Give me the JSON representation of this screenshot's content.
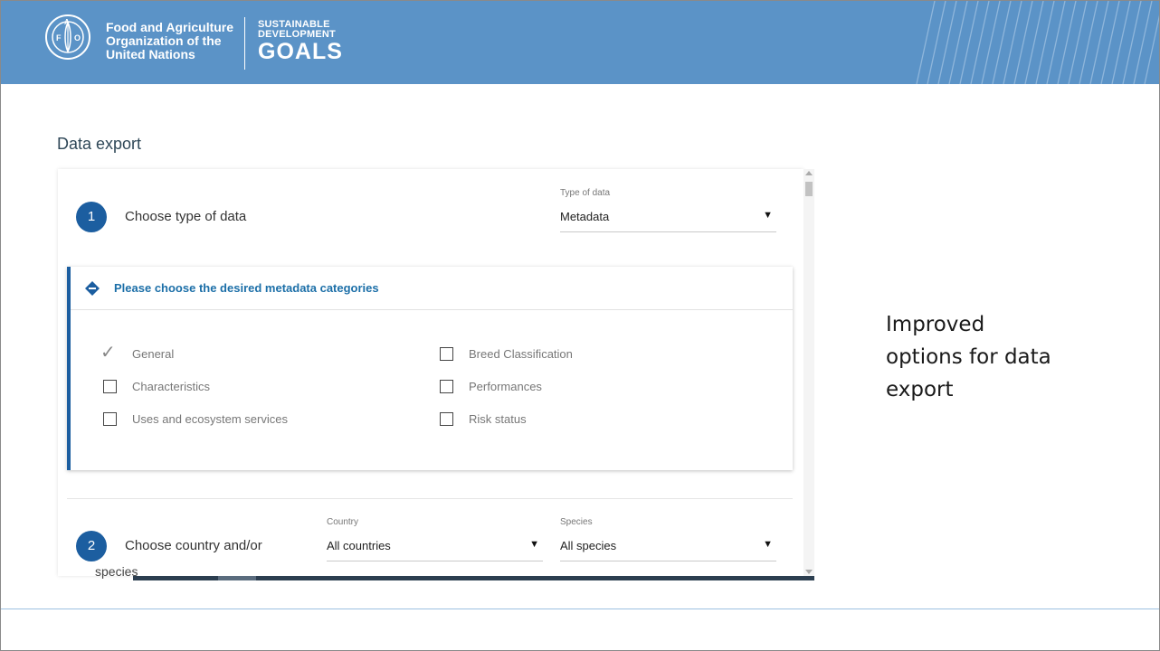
{
  "header": {
    "org_line1": "Food and Agriculture",
    "org_line2": "Organization of the",
    "org_line3": "United Nations",
    "sdg_line1": "SUSTAINABLE",
    "sdg_line2": "DEVELOPMENT",
    "sdg_line3": "GOALS",
    "brand_color": "#5b93c7"
  },
  "page": {
    "title": "Data export"
  },
  "step1": {
    "number": "1",
    "label": "Choose type of data",
    "type_field_label": "Type of data",
    "type_value": "Metadata"
  },
  "metadata_card": {
    "title": "Please choose the desired metadata categories",
    "options_left": [
      {
        "label": "General",
        "checked": true
      },
      {
        "label": "Characteristics",
        "checked": false
      },
      {
        "label": "Uses and ecosystem services",
        "checked": false
      }
    ],
    "options_right": [
      {
        "label": "Breed Classification",
        "checked": false
      },
      {
        "label": "Performances",
        "checked": false
      },
      {
        "label": "Risk status",
        "checked": false
      }
    ]
  },
  "step2": {
    "number": "2",
    "label": "Choose country and/or",
    "label_cont": "species",
    "country_field_label": "Country",
    "country_value": "All countries",
    "species_field_label": "Species",
    "species_value": "All species"
  },
  "side_note": {
    "line1": "Improved",
    "line2": "options for data",
    "line3": "export"
  },
  "accent_color": "#1c5ea0"
}
